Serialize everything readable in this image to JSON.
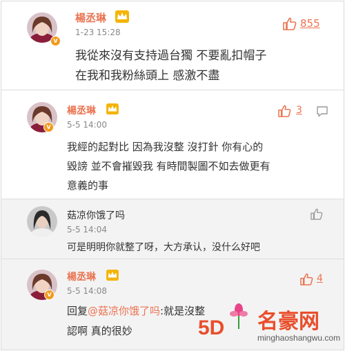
{
  "colors": {
    "accent": "#eb7350",
    "badge": "#f29a1b",
    "text": "#333333",
    "meta": "#888888"
  },
  "comments": [
    {
      "name": "楊丞琳",
      "time": "1-23 15:28",
      "likes": "855",
      "lines": [
        "我從來沒有支持過台獨 不要亂扣帽子",
        "在我和我粉絲頭上 感激不盡"
      ]
    },
    {
      "name": "楊丞琳",
      "time": "5-5 14:00",
      "likes": "3",
      "lines": [
        "我經的起對比 因為我沒整 沒打針  你有心的",
        "毀謗 並不會摧毀我 有時間製圖不如去做更有",
        "意義的事"
      ]
    },
    {
      "name": "菇凉你饿了吗",
      "time": "5-5 14:04",
      "lines": [
        "可是明明你就整了呀，大方承认，没什么好吧"
      ]
    },
    {
      "name": "楊丞琳",
      "time": "5-5 14:08",
      "likes": "4",
      "reply_prefix": "回复",
      "mention": "@菇凉你饿了吗",
      "line1_rest": ":就是沒整",
      "lines_after": [
        "認啊 真的很妙"
      ]
    }
  ],
  "watermark": {
    "logo_text": "5D",
    "brand": "名豪网",
    "url": "minghaoshangwu.com"
  }
}
